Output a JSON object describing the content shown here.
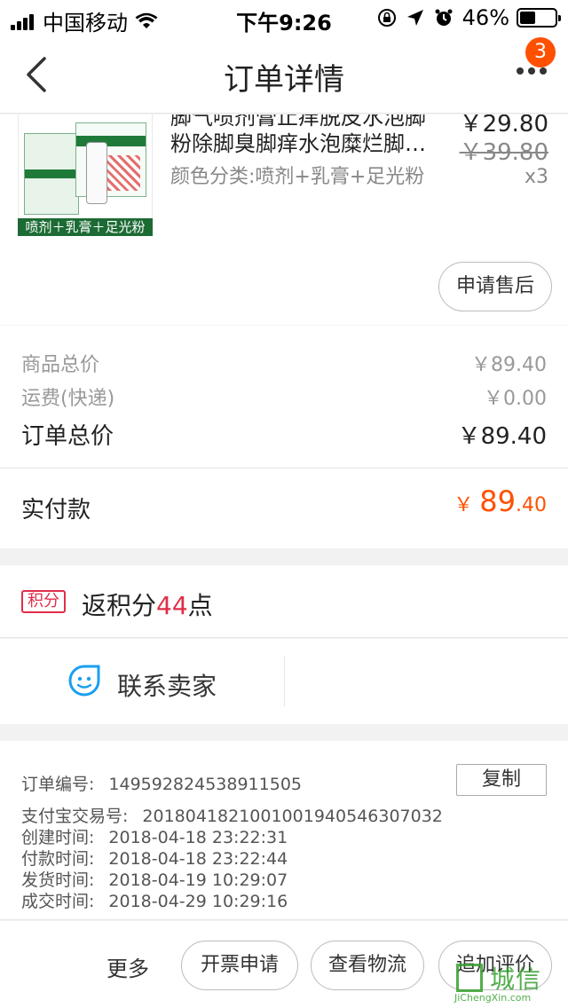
{
  "status_bar": {
    "carrier": "中国移动",
    "time": "下午9:26",
    "battery": "46%",
    "battery_level": 0.46
  },
  "nav": {
    "title": "订单详情",
    "badge_count": "3"
  },
  "product": {
    "name_line1": "脚气喷剂膏止痒脱皮水泡脚",
    "name_line2": "粉除脚臭脚痒水泡糜烂脚…",
    "spec": "颜色分类:喷剂+乳膏+足光粉",
    "price": "￥29.80",
    "original_price": "￥39.80",
    "quantity": "x3",
    "image_tag": "喷剂＋乳膏＋足光粉",
    "after_sale_button": "申请售后"
  },
  "summary": {
    "goods_total_label": "商品总价",
    "goods_total_value": "￥89.40",
    "shipping_label": "运费(快递)",
    "shipping_value": "￥0.00",
    "order_total_label": "订单总价",
    "order_total_value": "￥89.40"
  },
  "paid": {
    "label": "实付款",
    "currency": "￥",
    "amount_int": "89",
    "amount_dec": ".40"
  },
  "points": {
    "badge": "积分",
    "text_prefix": "返积分",
    "num": "44",
    "text_suffix": "点"
  },
  "contact": {
    "label": "联系卖家"
  },
  "order_info": {
    "copy_button": "复制",
    "rows": [
      {
        "key": "订单编号:",
        "value": "149592824538911505"
      },
      {
        "key": "支付宝交易号:",
        "value": "2018041821001001940546307032"
      },
      {
        "key": "创建时间:",
        "value": "2018-04-18 23:22:31"
      },
      {
        "key": "付款时间:",
        "value": "2018-04-18 23:22:44"
      },
      {
        "key": "发货时间:",
        "value": "2018-04-19 10:29:07"
      },
      {
        "key": "成交时间:",
        "value": "2018-04-29 10:29:16"
      }
    ]
  },
  "bottom_bar": {
    "more": "更多",
    "invoice_button": "开票申请",
    "logistics_button": "查看物流",
    "review_button": "追加评价"
  },
  "watermark": {
    "text": "城信",
    "url": "JiChengXin.com"
  }
}
